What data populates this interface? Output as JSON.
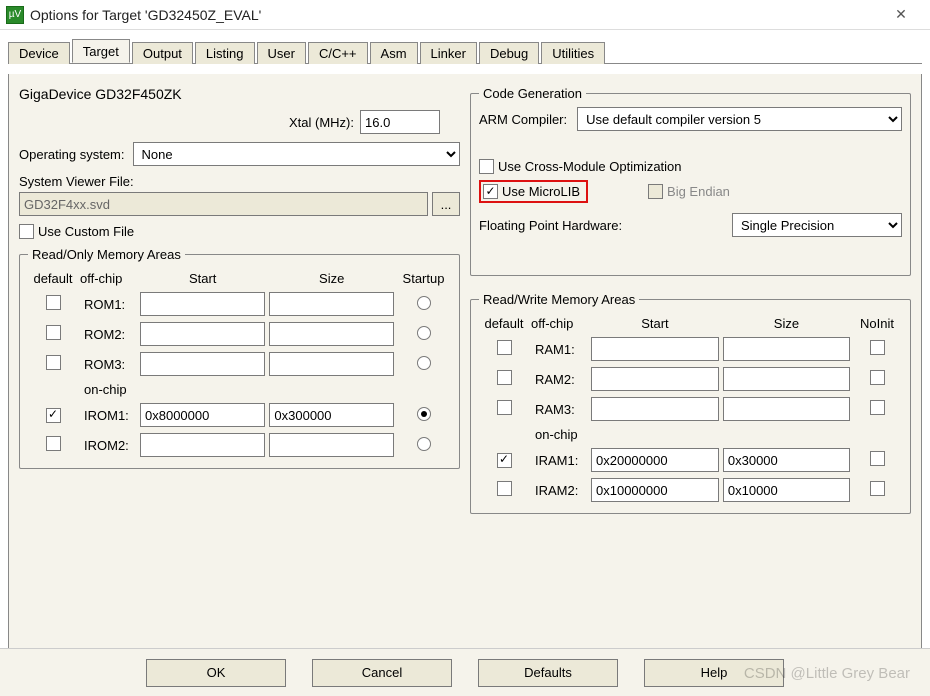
{
  "title": "Options for Target 'GD32450Z_EVAL'",
  "tabs": [
    "Device",
    "Target",
    "Output",
    "Listing",
    "User",
    "C/C++",
    "Asm",
    "Linker",
    "Debug",
    "Utilities"
  ],
  "active_tab": "Target",
  "device_name": "GigaDevice GD32F450ZK",
  "xtal_label": "Xtal (MHz):",
  "xtal_value": "16.0",
  "os_label": "Operating system:",
  "os_value": "None",
  "svf_label": "System Viewer File:",
  "svf_value": "GD32F4xx.svd",
  "svf_browse": "...",
  "use_custom_file_label": "Use Custom File",
  "use_custom_file_checked": false,
  "codegen": {
    "legend": "Code Generation",
    "arm_compiler_label": "ARM Compiler:",
    "arm_compiler_value": "Use default compiler version 5",
    "cross_module_label": "Use Cross-Module Optimization",
    "cross_module_checked": false,
    "use_microlib_label": "Use MicroLIB",
    "use_microlib_checked": true,
    "big_endian_label": "Big Endian",
    "big_endian_checked": false,
    "fph_label": "Floating Point Hardware:",
    "fph_value": "Single Precision"
  },
  "ro": {
    "legend": "Read/Only Memory Areas",
    "hdr": {
      "default": "default",
      "offchip": "off-chip",
      "start": "Start",
      "size": "Size",
      "startup": "Startup",
      "onchip": "on-chip"
    },
    "rows": [
      {
        "label": "ROM1:",
        "def": false,
        "start": "",
        "size": "",
        "startup": false
      },
      {
        "label": "ROM2:",
        "def": false,
        "start": "",
        "size": "",
        "startup": false
      },
      {
        "label": "ROM3:",
        "def": false,
        "start": "",
        "size": "",
        "startup": false
      }
    ],
    "onchip_rows": [
      {
        "label": "IROM1:",
        "def": true,
        "start": "0x8000000",
        "size": "0x300000",
        "startup": true
      },
      {
        "label": "IROM2:",
        "def": false,
        "start": "",
        "size": "",
        "startup": false
      }
    ]
  },
  "rw": {
    "legend": "Read/Write Memory Areas",
    "hdr": {
      "default": "default",
      "offchip": "off-chip",
      "start": "Start",
      "size": "Size",
      "noinit": "NoInit",
      "onchip": "on-chip"
    },
    "rows": [
      {
        "label": "RAM1:",
        "def": false,
        "start": "",
        "size": "",
        "noinit": false
      },
      {
        "label": "RAM2:",
        "def": false,
        "start": "",
        "size": "",
        "noinit": false
      },
      {
        "label": "RAM3:",
        "def": false,
        "start": "",
        "size": "",
        "noinit": false
      }
    ],
    "onchip_rows": [
      {
        "label": "IRAM1:",
        "def": true,
        "start": "0x20000000",
        "size": "0x30000",
        "noinit": false
      },
      {
        "label": "IRAM2:",
        "def": false,
        "start": "0x10000000",
        "size": "0x10000",
        "noinit": false
      }
    ]
  },
  "buttons": {
    "ok": "OK",
    "cancel": "Cancel",
    "defaults": "Defaults",
    "help": "Help"
  },
  "watermark": "CSDN @Little Grey Bear"
}
